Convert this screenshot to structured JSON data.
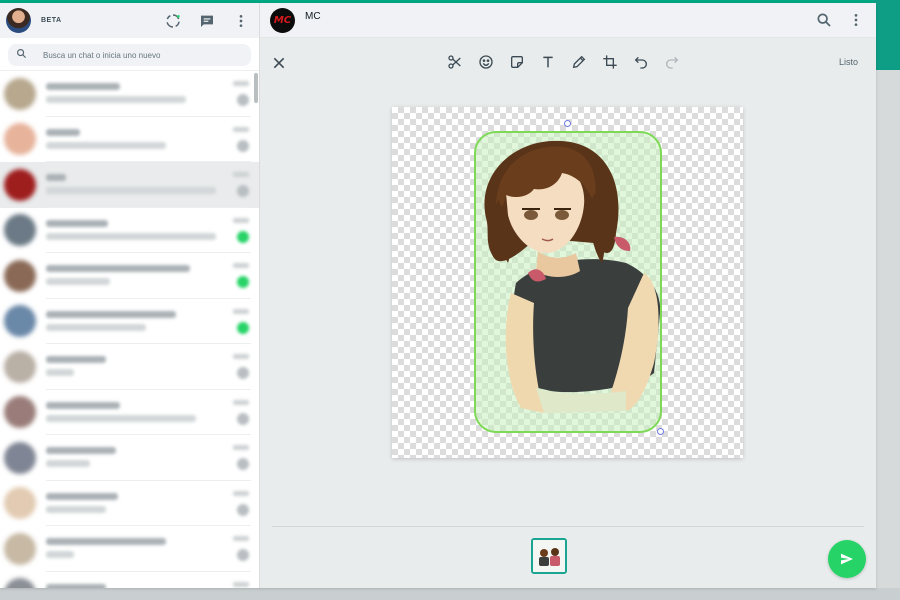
{
  "sidebar": {
    "beta_label": "BETA",
    "search": {
      "placeholder": "Busca un chat o inicia uno nuevo",
      "value": ""
    },
    "icons": [
      "status-icon",
      "new-chat-icon",
      "menu-icon",
      "search-icon"
    ],
    "chats": [
      {
        "avatar_color": "#b7a88e",
        "name_w": 74,
        "sub_w": 140,
        "badge": false
      },
      {
        "avatar_color": "#e7b39b",
        "name_w": 34,
        "sub_w": 120,
        "badge": false
      },
      {
        "avatar_color": "#9e1d1d",
        "name_w": 20,
        "sub_w": 170,
        "badge": false,
        "selected": true
      },
      {
        "avatar_color": "#6b7a86",
        "name_w": 62,
        "sub_w": 170,
        "badge": true
      },
      {
        "avatar_color": "#8a6a56",
        "name_w": 144,
        "sub_w": 64,
        "badge": true
      },
      {
        "avatar_color": "#6a88a8",
        "name_w": 130,
        "sub_w": 100,
        "badge": true
      },
      {
        "avatar_color": "#b9b0a6",
        "name_w": 60,
        "sub_w": 28,
        "badge": false
      },
      {
        "avatar_color": "#9a7d7a",
        "name_w": 74,
        "sub_w": 150,
        "badge": false
      },
      {
        "avatar_color": "#7f8594",
        "name_w": 70,
        "sub_w": 44,
        "badge": false
      },
      {
        "avatar_color": "#e2cbb2",
        "name_w": 72,
        "sub_w": 60,
        "badge": false
      },
      {
        "avatar_color": "#c7b9a4",
        "name_w": 120,
        "sub_w": 28,
        "badge": false
      },
      {
        "avatar_color": "#8b8f96",
        "name_w": 60,
        "sub_w": 50,
        "badge": false
      }
    ]
  },
  "main": {
    "contact": {
      "avatar_text": "MC",
      "name": "MC"
    },
    "header_icons": [
      "search-icon",
      "menu-icon"
    ]
  },
  "editor": {
    "tools": [
      "close-icon",
      "scissors-icon",
      "emoji-icon",
      "sticker-icon",
      "text-icon",
      "pencil-icon",
      "crop-icon",
      "undo-icon",
      "redo-icon"
    ],
    "done_label": "Listo"
  },
  "colors": {
    "accent": "#00a884",
    "send_button": "#25d366",
    "sticker_border": "#7ed957",
    "thumb_border": "#1aa592"
  }
}
